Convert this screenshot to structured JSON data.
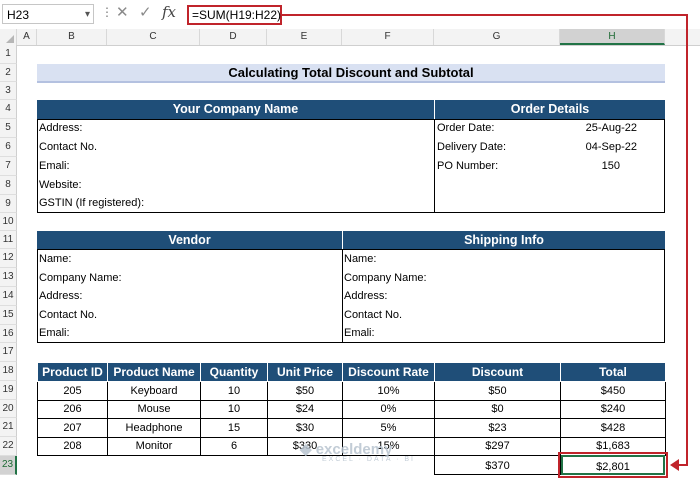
{
  "formula_bar": {
    "name_box": "H23",
    "cancel_icon": "✕",
    "enter_icon": "✓",
    "fx_icon": "fx",
    "formula": "=SUM(H19:H22)"
  },
  "columns": [
    "A",
    "B",
    "C",
    "D",
    "E",
    "F",
    "G",
    "H"
  ],
  "rows": [
    "1",
    "2",
    "3",
    "4",
    "5",
    "6",
    "7",
    "8",
    "9",
    "10",
    "11",
    "12",
    "13",
    "14",
    "15",
    "16",
    "17",
    "18",
    "19",
    "20",
    "21",
    "22",
    "23"
  ],
  "sheet": {
    "title": "Calculating Total Discount and Subtotal",
    "company": {
      "header": "Your Company Name",
      "fields": [
        "Address:",
        "Contact No.",
        "Emali:",
        "Website:",
        "GSTIN (If registered):"
      ]
    },
    "order": {
      "header": "Order Details",
      "fields": [
        {
          "label": "Order Date:",
          "value": "25-Aug-22"
        },
        {
          "label": "Delivery Date:",
          "value": "04-Sep-22"
        },
        {
          "label": "PO Number:",
          "value": "150"
        }
      ]
    },
    "vendor": {
      "header": "Vendor",
      "fields": [
        "Name:",
        "Company Name:",
        "Address:",
        "Contact No.",
        "Emali:"
      ]
    },
    "shipping": {
      "header": "Shipping Info",
      "fields": [
        "Name:",
        "Company Name:",
        "Address:",
        "Contact No.",
        "Emali:"
      ]
    },
    "table": {
      "headers": [
        "Product ID",
        "Product Name",
        "Quantity",
        "Unit Price",
        "Discount Rate",
        "Discount",
        "Total"
      ],
      "rows": [
        [
          "205",
          "Keyboard",
          "10",
          "$50",
          "10%",
          "$50",
          "$450"
        ],
        [
          "206",
          "Mouse",
          "10",
          "$24",
          "0%",
          "$0",
          "$240"
        ],
        [
          "207",
          "Headphone",
          "15",
          "$30",
          "5%",
          "$23",
          "$428"
        ],
        [
          "208",
          "Monitor",
          "6",
          "$330",
          "15%",
          "$297",
          "$1,683"
        ]
      ],
      "total_discount": "$370",
      "subtotal": "$2,801"
    },
    "watermark": {
      "name": "exceldemy",
      "tag": "EXCEL · DATA · BI"
    }
  },
  "colors": {
    "header_blue": "#1f4e78",
    "title_band": "#d9e1f2",
    "highlight_red": "#c0242b",
    "select_green": "#217346"
  }
}
